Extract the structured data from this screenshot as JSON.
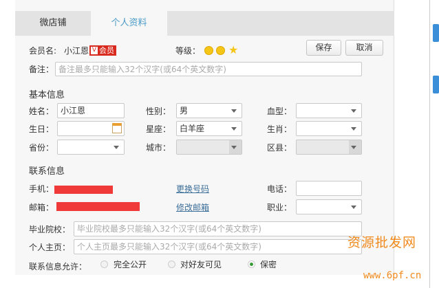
{
  "tabs": [
    {
      "label": "微店铺",
      "active": false
    },
    {
      "label": "个人资料",
      "active": true
    }
  ],
  "member": {
    "label": "会员名:",
    "name": "小江恩",
    "badge": "会员",
    "level_label": "等级：",
    "level_icons": [
      "sun",
      "sun",
      "star"
    ]
  },
  "buttons": {
    "save": "保存",
    "cancel": "取消"
  },
  "remark": {
    "label": "备注：",
    "placeholder": "备注最多只能输入32个汉字(或64个英文数字)"
  },
  "basic": {
    "title": "基本信息",
    "name_label": "姓名：",
    "name_value": "小江恩",
    "gender_label": "性别：",
    "gender_value": "男",
    "blood_label": "血型：",
    "blood_value": "",
    "birthday_label": "生日：",
    "birthday_value": "",
    "zodiac_label": "星座：",
    "zodiac_value": "白羊座",
    "animal_label": "生肖：",
    "animal_value": "",
    "province_label": "省份：",
    "city_label": "城市：",
    "district_label": "区县："
  },
  "contact": {
    "title": "联系信息",
    "mobile_label": "手机：",
    "change_mobile": "更换号码",
    "phone_label": "电话：",
    "email_label": "邮箱：",
    "change_email": "修改邮箱",
    "job_label": "职业：",
    "school_label": "毕业院校：",
    "school_placeholder": "毕业院校最多只能输入32个汉字(或64个英文数字)",
    "homepage_label": "个人主页：",
    "homepage_placeholder": "个人主页最多只能输入32个汉字(或64个英文数字)",
    "privacy_label": "联系信息允许：",
    "privacy_options": [
      {
        "label": "完全公开",
        "checked": false
      },
      {
        "label": "对好友可见",
        "checked": false
      },
      {
        "label": "保密",
        "checked": true
      }
    ]
  },
  "watermark": {
    "title": "资源批发网",
    "url": "www.6pf.cn"
  },
  "colors": {
    "active_tab": "#4a9ac8",
    "redaction": "#f03a3a",
    "radio_checked": "#3a9a3a",
    "watermark": "#f08a1c"
  }
}
